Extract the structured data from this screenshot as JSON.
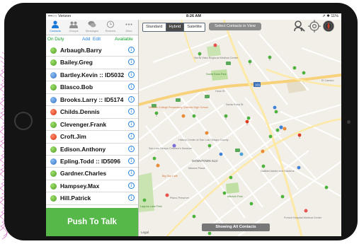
{
  "status_bar": {
    "carrier": "•••○○ Verizon",
    "time": "8:26 AM",
    "battery": "⇗ ✱ 11%"
  },
  "tabs": [
    {
      "label": "Contacts",
      "icon": "person-icon"
    },
    {
      "label": "Groups",
      "icon": "groups-icon"
    },
    {
      "label": "Messages",
      "icon": "messages-icon"
    },
    {
      "label": "Recents",
      "icon": "clock-icon"
    },
    {
      "label": "More",
      "icon": "more-icon"
    }
  ],
  "toolbar": {
    "duty": "On Duty",
    "add": "Add",
    "edit": "Edit",
    "available": "Available"
  },
  "contacts": [
    {
      "name": "Arbaugh.Barry",
      "status": "green"
    },
    {
      "name": "Bailey.Greg",
      "status": "green"
    },
    {
      "name": "Bartley.Kevin :: ID5032",
      "status": "blue"
    },
    {
      "name": "Blasco.Bob",
      "status": "green"
    },
    {
      "name": "Brooks.Larry :: ID5174",
      "status": "blue"
    },
    {
      "name": "Childs.Dennis",
      "status": "red"
    },
    {
      "name": "Clevenger.Frank",
      "status": "green"
    },
    {
      "name": "Croft.Jim",
      "status": "red"
    },
    {
      "name": "Edison.Anthony",
      "status": "green"
    },
    {
      "name": "Epling.Todd :: ID5096",
      "status": "blue"
    },
    {
      "name": "Gardner.Charles",
      "status": "green"
    },
    {
      "name": "Hampsey.Max",
      "status": "green"
    },
    {
      "name": "Hill.Patrick",
      "status": "green"
    }
  ],
  "push_to_talk": "Push To Talk",
  "map": {
    "modes": [
      "Standard",
      "Hybrid",
      "Satellite"
    ],
    "selected_mode": "Hybrid",
    "select_button": "Select Contacts in View",
    "footer": "Showing All Contacts",
    "legal": "Legal",
    "labels": {
      "sierra_vista": "Sierra Vista Regional Medical Center",
      "santa_rosa_park": "Santa Rosa Park",
      "mission_college": "Mission College Preparatory Catholic High School",
      "history_center": "History Center of San Luis Obispo County",
      "childrens_museum": "San Luis Obispo Children's Museum",
      "downtown": "DOWNTOWN SLO",
      "big_sky": "Big Sky Cafe",
      "mission_plaza": "Mission Plaza",
      "dallidet": "Dallidet Adobe and Gardens",
      "mitchell_park": "Mitchell Park",
      "french_hospital": "French Hospital Medical Center",
      "pismo_preserve": "Pismo Preserve",
      "laguna_lake": "Laguna Lake Park",
      "santa_rosa_st": "Santa Rosa St",
      "el_camino": "El Camino",
      "osos_st": "Osos St"
    }
  },
  "colors": {
    "accent_green": "#57b84a",
    "link_blue": "#1f7fe0",
    "duty_green": "#12a12d"
  }
}
